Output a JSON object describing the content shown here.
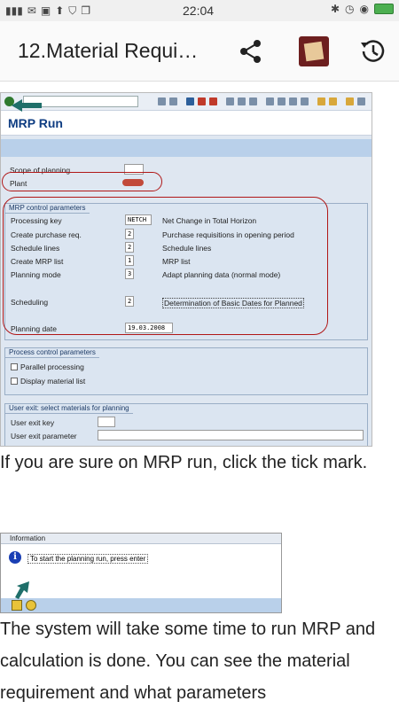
{
  "status": {
    "time": "22:04"
  },
  "appbar": {
    "title": "12.Material Requi…"
  },
  "sap": {
    "title": "MRP Run",
    "scope_label": "Scope of planning",
    "plant_label": "Plant",
    "mrp_group_title": "MRP control parameters",
    "rows": [
      {
        "label": "Processing key",
        "value": "NETCH",
        "desc": "Net Change in Total Horizon"
      },
      {
        "label": "Create purchase req.",
        "value": "2",
        "desc": "Purchase requisitions in opening period"
      },
      {
        "label": "Schedule lines",
        "value": "2",
        "desc": "Schedule lines"
      },
      {
        "label": "Create MRP list",
        "value": "1",
        "desc": "MRP list"
      },
      {
        "label": "Planning mode",
        "value": "3",
        "desc": "Adapt planning data (normal mode)"
      },
      {
        "label": "Scheduling",
        "value": "2",
        "desc": "Determination of Basic Dates for Planned"
      }
    ],
    "planning_date_label": "Planning date",
    "planning_date_value": "19.03.2008",
    "process_group_title": "Process control parameters",
    "parallel_label": "Parallel processing",
    "display_label": "Display material list",
    "exit_group_title": "User exit: select materials for planning",
    "exit_key_label": "User exit key",
    "exit_param_label": "User exit parameter"
  },
  "text1": "If you are sure on MRP run, click the tick mark.",
  "info": {
    "title": "Information",
    "message": "To start the planning run, press enter"
  },
  "text2": "The system will take some time to run MRP and calculation is done. You can see the material requirement and what parameters"
}
